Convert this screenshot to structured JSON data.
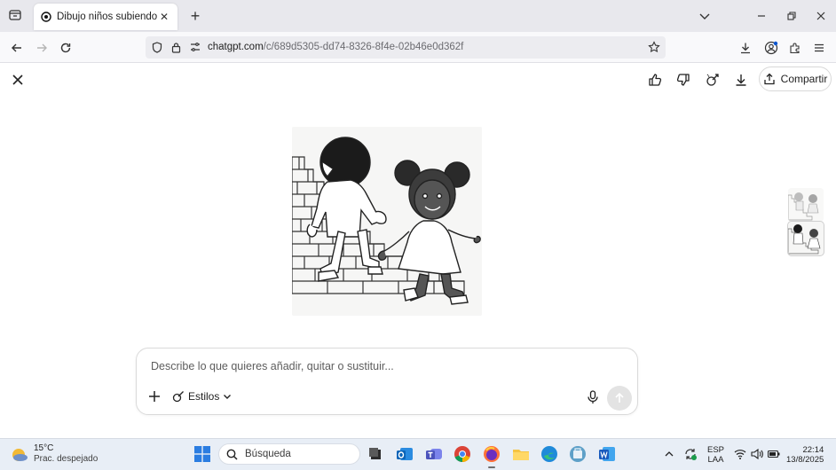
{
  "browser": {
    "tab": {
      "title": "Dibujo niños subiendo bajando"
    },
    "url": {
      "domain": "chatgpt.com",
      "path": "/c/689d5305-dd74-8326-8f4e-02b46e0d362f"
    }
  },
  "image_view": {
    "share_label": "Compartir",
    "image_alt": "Dibujo niños subiendo bajando"
  },
  "composer": {
    "placeholder": "Describe lo que quieres añadir, quitar o sustituir...",
    "styles_label": "Estilos"
  },
  "taskbar": {
    "weather": {
      "temp": "15°C",
      "desc": "Prac. despejado"
    },
    "search_placeholder": "Búsqueda",
    "language": {
      "line1": "ESP",
      "line2": "LAA"
    },
    "clock": {
      "time": "22:14",
      "date": "13/8/2025"
    }
  },
  "colors": {
    "accent": "#0b57d0",
    "tabbar_bg": "#e8e8ed",
    "taskbar_bg": "#e8eef6"
  }
}
